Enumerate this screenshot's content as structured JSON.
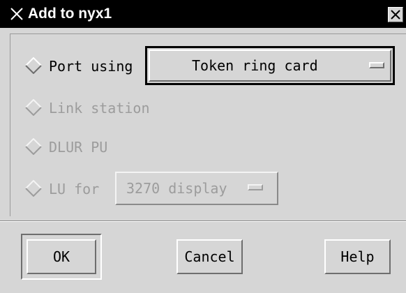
{
  "window": {
    "title": "Add to nyx1"
  },
  "options": [
    {
      "label": "Port using",
      "enabled": true,
      "selected": false
    },
    {
      "label": "Link station",
      "enabled": false,
      "selected": false
    },
    {
      "label": "DLUR PU",
      "enabled": false,
      "selected": false
    },
    {
      "label": "LU for",
      "enabled": false,
      "selected": false
    }
  ],
  "port_menu": {
    "value": "Token ring card"
  },
  "lu_menu": {
    "value": "3270 display"
  },
  "buttons": {
    "ok": "OK",
    "cancel": "Cancel",
    "help": "Help"
  },
  "icons": {
    "window_menu": "close-x-icon",
    "close": "close-icon",
    "radio": "diamond-radio-icon",
    "option_indicator": "option-menu-indicator-icon"
  }
}
